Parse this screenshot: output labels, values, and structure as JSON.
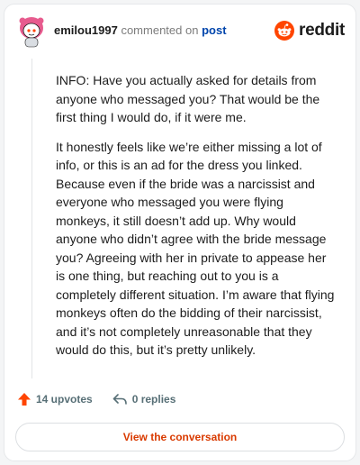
{
  "comment": {
    "username": "emilou1997",
    "action_text": "commented on",
    "post_link": "post",
    "paragraphs": [
      "INFO: Have you actually asked for details from anyone who messaged you? That would be the first thing I would do, if it were me.",
      "It honestly feels like we’re either missing a lot of info, or this is an ad for the dress you linked. Because even if the bride was a narcissist and everyone who messaged you were flying monkeys, it still doesn’t add up. Why would anyone who didn’t agree with the bride message you? Agreeing with her in private to appease her is one thing, but reaching out to you is a completely different situation. I’m aware that flying monkeys often do the bidding of their narcissist, and it’s not completely unreasonable that they would do this, but it’s pretty unlikely."
    ],
    "upvotes": "14 upvotes",
    "replies": "0 replies"
  },
  "brand": {
    "name": "reddit",
    "accent": "#ff4500"
  },
  "cta": {
    "label": "View the conversation"
  },
  "colors": {
    "link": "#0045ac",
    "upvote": "#ff4500",
    "cta_text": "#d93a00",
    "avatar_hair": "#e75b8e"
  },
  "icons": [
    "snoo-avatar",
    "reddit-alien-icon",
    "upvote-arrow-icon",
    "reply-arrow-icon"
  ]
}
